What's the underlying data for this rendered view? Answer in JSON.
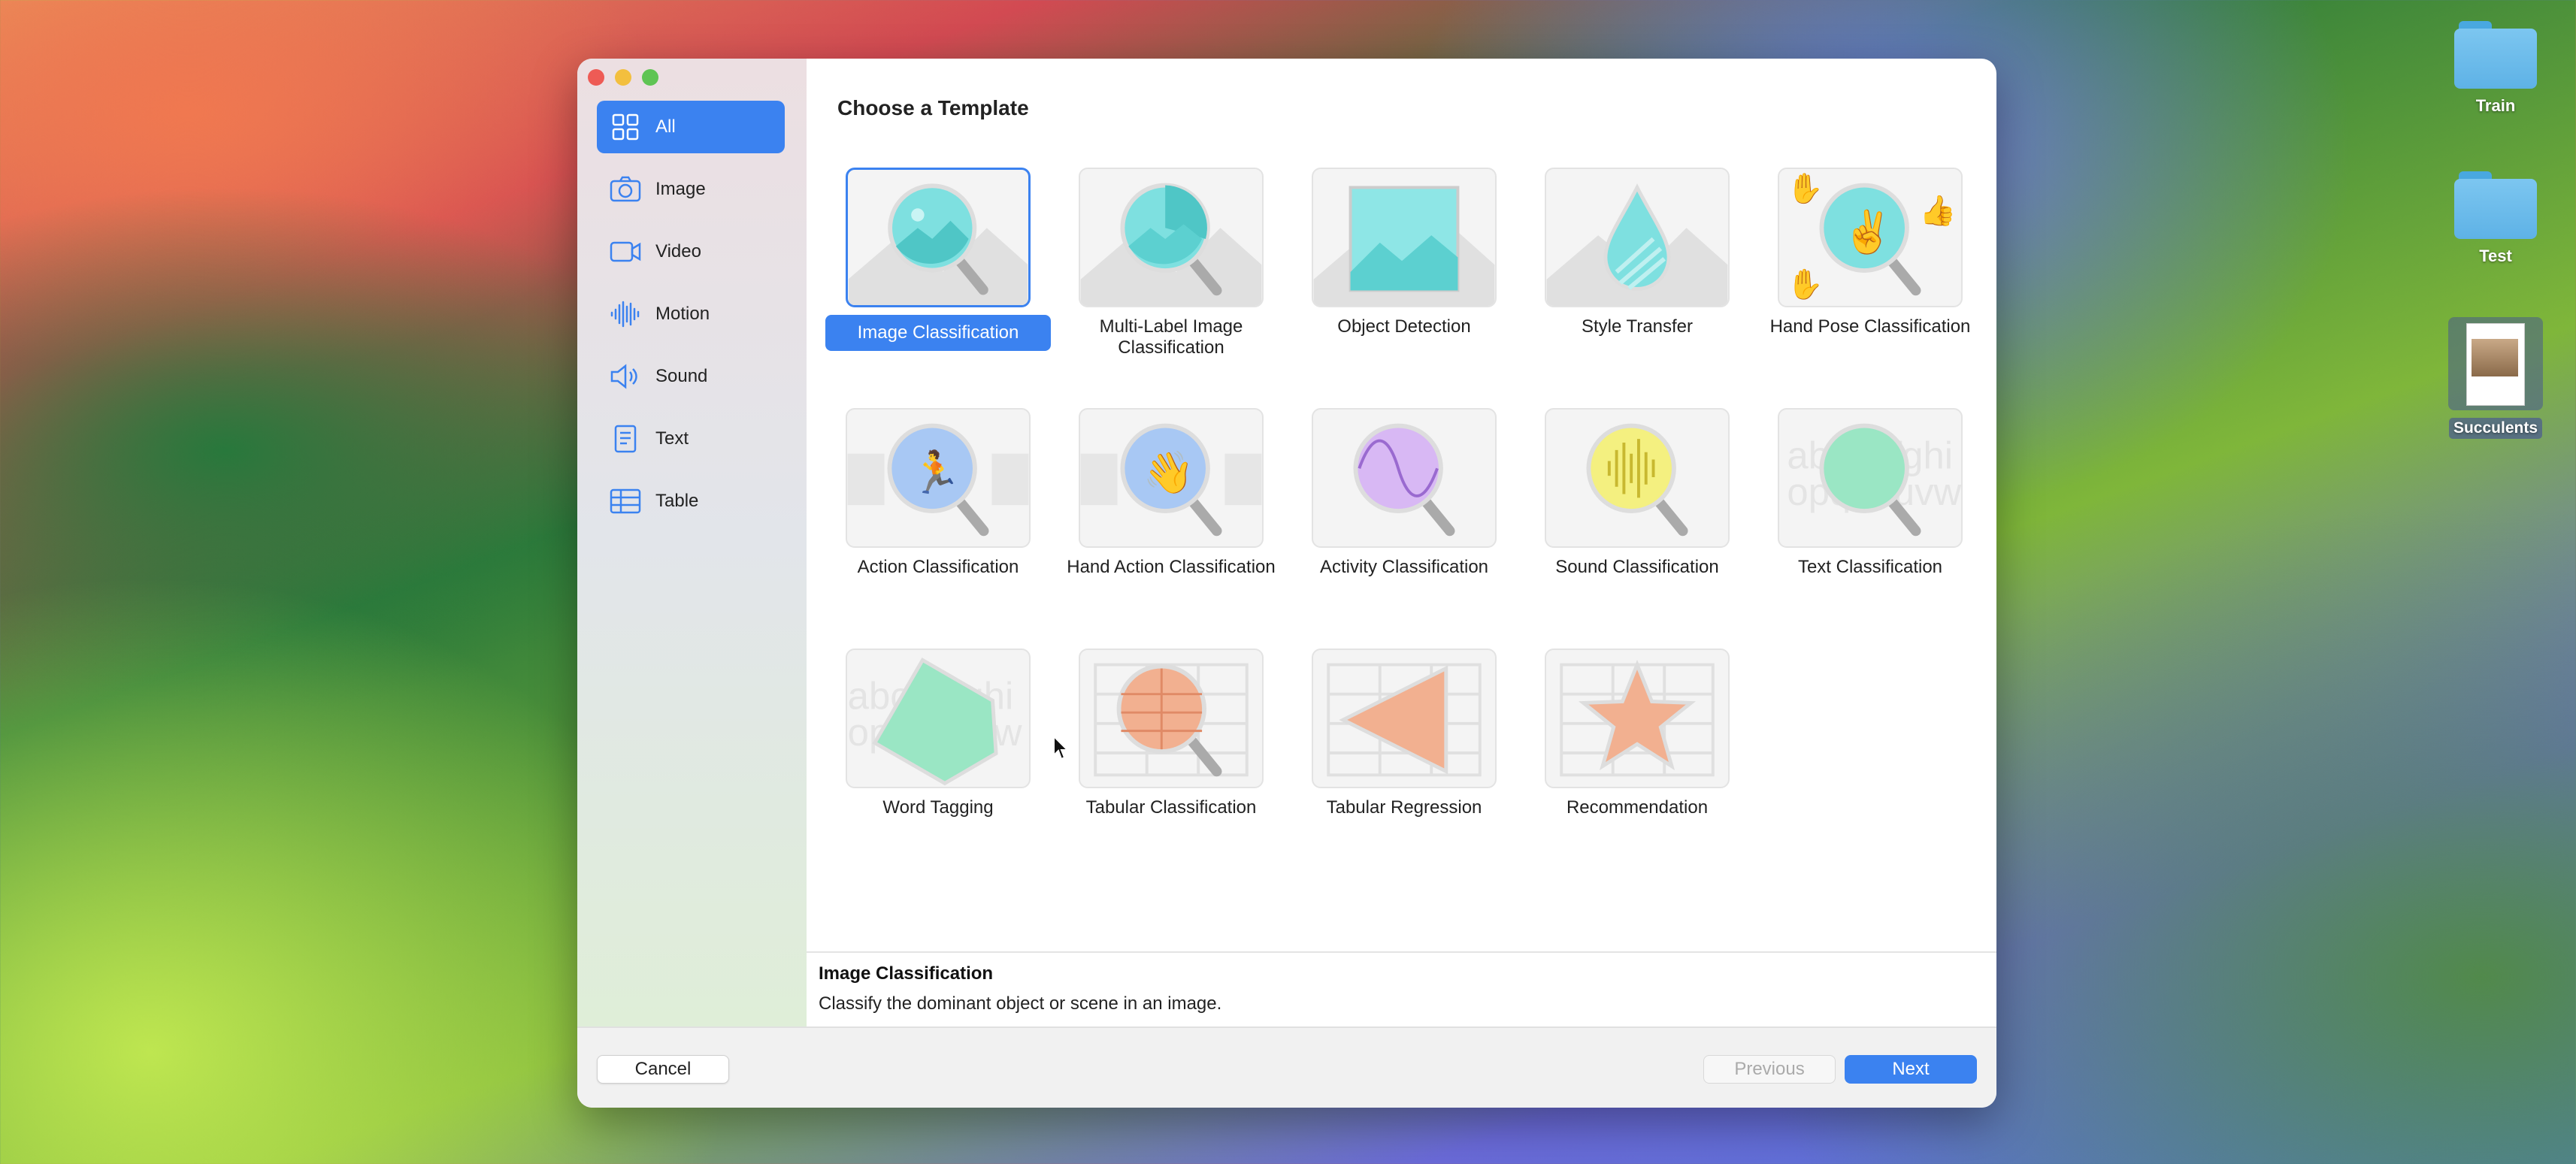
{
  "desktop": {
    "icons": [
      {
        "label": "Train",
        "type": "folder"
      },
      {
        "label": "Test",
        "type": "folder"
      },
      {
        "label": "Succulents",
        "type": "image-file"
      }
    ]
  },
  "window": {
    "sidebar": {
      "items": [
        {
          "label": "All",
          "icon": "grid-icon",
          "active": true
        },
        {
          "label": "Image",
          "icon": "camera-icon"
        },
        {
          "label": "Video",
          "icon": "video-icon"
        },
        {
          "label": "Motion",
          "icon": "waveform-icon"
        },
        {
          "label": "Sound",
          "icon": "speaker-icon"
        },
        {
          "label": "Text",
          "icon": "document-icon"
        },
        {
          "label": "Table",
          "icon": "table-icon"
        }
      ]
    },
    "title": "Choose a Template",
    "templates": [
      {
        "label": "Image Classification",
        "selected": true
      },
      {
        "label": "Multi-Label Image Classification"
      },
      {
        "label": "Object Detection"
      },
      {
        "label": "Style Transfer"
      },
      {
        "label": "Hand Pose Classification"
      },
      {
        "label": "Action Classification"
      },
      {
        "label": "Hand Action Classification"
      },
      {
        "label": "Activity Classification"
      },
      {
        "label": "Sound Classification"
      },
      {
        "label": "Text Classification"
      },
      {
        "label": "Word Tagging"
      },
      {
        "label": "Tabular Classification"
      },
      {
        "label": "Tabular Regression"
      },
      {
        "label": "Recommendation"
      }
    ],
    "description": {
      "title": "Image Classification",
      "text": "Classify the dominant object or scene in an image."
    },
    "footer": {
      "cancel_label": "Cancel",
      "previous_label": "Previous",
      "next_label": "Next"
    }
  },
  "colors": {
    "accent": "#3b82f0",
    "close": "#ee5b55",
    "minimize": "#f3bf3e",
    "zoom": "#5fc453"
  }
}
